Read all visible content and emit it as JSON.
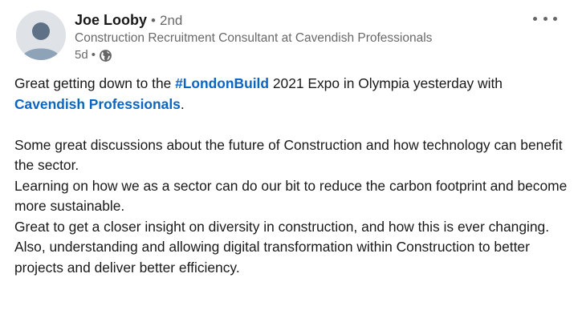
{
  "author": {
    "name": "Joe Looby",
    "separator": "•",
    "degree": "2nd",
    "headline": "Construction Recruitment Consultant at Cavendish Professionals",
    "time": "5d",
    "meta_separator": "•",
    "visibility_icon": "globe-icon"
  },
  "menu": {
    "icon": "more-options-icon"
  },
  "post": {
    "p1_a": "Great getting down to the ",
    "hashtag": "#LondonBuild",
    "p1_b": " 2021 Expo in Olympia yesterday with",
    "mention": "Cavendish Professionals",
    "p1_c": ".",
    "line1": "Some great discussions about the future of Construction and how technology can benefit the sector.",
    "line2": "Learning on how we as a sector can do our bit to reduce the carbon footprint and become more sustainable.",
    "line3": "Great to get a closer insight on diversity in construction, and how this is ever changing.",
    "line4": "Also, understanding and allowing digital transformation within Construction to better projects and deliver better efficiency."
  },
  "colors": {
    "link": "#0a66c2",
    "muted": "#666666",
    "text": "#191919"
  }
}
